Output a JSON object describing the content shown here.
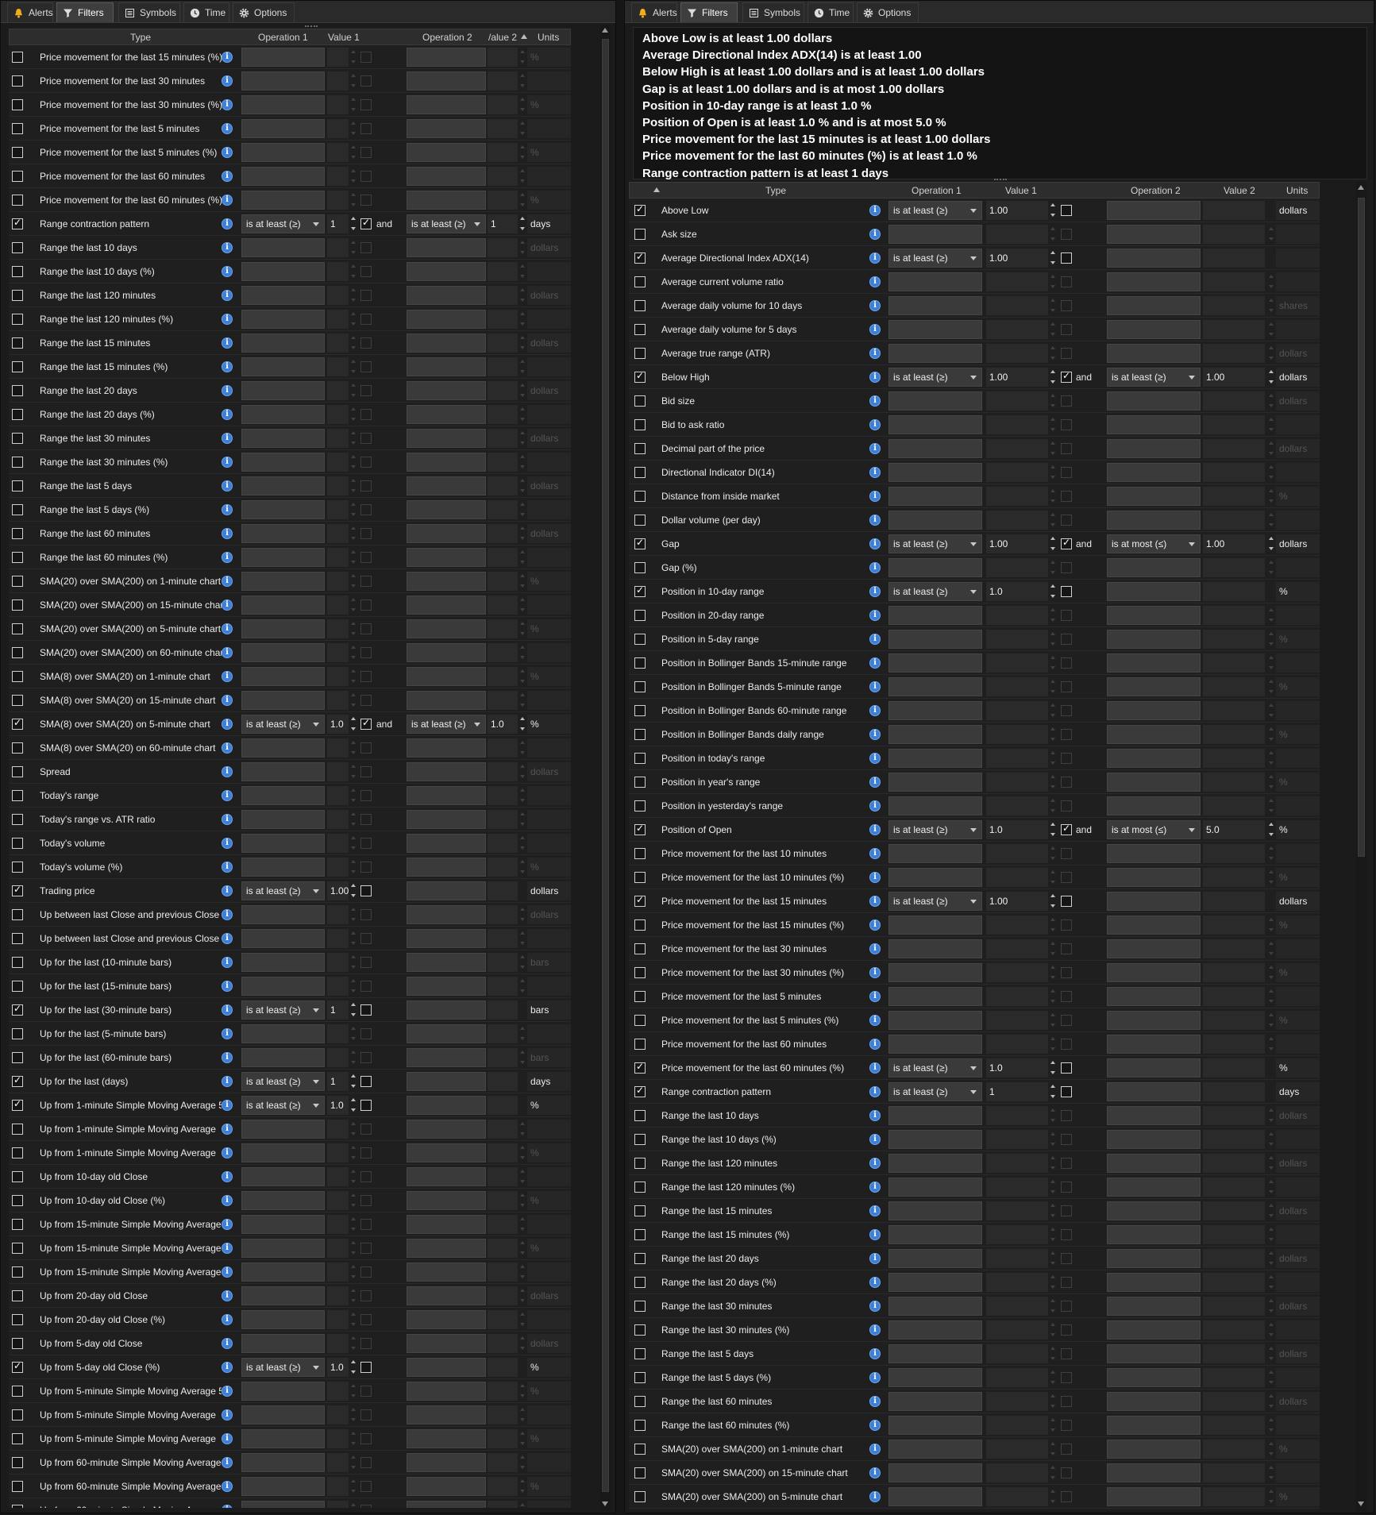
{
  "tabs": [
    {
      "label": "Alerts",
      "icon": "bell-icon"
    },
    {
      "label": "Filters",
      "icon": "funnel-icon",
      "active": true
    },
    {
      "label": "Symbols",
      "icon": "list-icon"
    },
    {
      "label": "Time",
      "icon": "clock-icon"
    },
    {
      "label": "Options",
      "icon": "gear-icon"
    }
  ],
  "and_label": "and",
  "left": {
    "headers": {
      "type": "Type",
      "op1": "Operation 1",
      "val1": "Value 1",
      "op2": "Operation 2",
      "val2": "/alue 2",
      "units": "Units"
    },
    "rows": [
      {
        "label": "Price movement for the last 15 minutes (%)",
        "units": "%"
      },
      {
        "label": "Price movement for the last 30 minutes"
      },
      {
        "label": "Price movement for the last 30 minutes (%)",
        "units": "%"
      },
      {
        "label": "Price movement for the last 5 minutes"
      },
      {
        "label": "Price movement for the last 5 minutes (%)",
        "units": "%"
      },
      {
        "label": "Price movement for the last 60 minutes"
      },
      {
        "label": "Price movement for the last 60 minutes (%)",
        "units": "%"
      },
      {
        "label": "Range contraction pattern",
        "checked": true,
        "op1": "is at least (≥)",
        "val1": "1",
        "and": true,
        "op2": "is at least (≥)",
        "val2": "1",
        "units": "days"
      },
      {
        "label": "Range the last 10 days",
        "units": "dollars"
      },
      {
        "label": "Range the last 10 days (%)"
      },
      {
        "label": "Range the last 120 minutes",
        "units": "dollars"
      },
      {
        "label": "Range the last 120 minutes (%)"
      },
      {
        "label": "Range the last 15 minutes",
        "units": "dollars"
      },
      {
        "label": "Range the last 15 minutes (%)"
      },
      {
        "label": "Range the last 20 days",
        "units": "dollars"
      },
      {
        "label": "Range the last 20 days (%)"
      },
      {
        "label": "Range the last 30 minutes",
        "units": "dollars"
      },
      {
        "label": "Range the last 30 minutes (%)"
      },
      {
        "label": "Range the last 5 days",
        "units": "dollars"
      },
      {
        "label": "Range the last 5 days (%)"
      },
      {
        "label": "Range the last 60 minutes",
        "units": "dollars"
      },
      {
        "label": "Range the last 60 minutes (%)"
      },
      {
        "label": "SMA(20) over SMA(200) on 1-minute chart",
        "units": "%"
      },
      {
        "label": "SMA(20) over SMA(200) on 15-minute chart"
      },
      {
        "label": "SMA(20) over SMA(200) on 5-minute chart",
        "units": "%"
      },
      {
        "label": "SMA(20) over SMA(200) on 60-minute chart"
      },
      {
        "label": "SMA(8) over SMA(20) on 1-minute chart",
        "units": "%"
      },
      {
        "label": "SMA(8) over SMA(20) on 15-minute chart"
      },
      {
        "label": "SMA(8) over SMA(20) on 5-minute chart",
        "checked": true,
        "op1": "is at least (≥)",
        "val1": "1.0",
        "and": true,
        "op2": "is at least (≥)",
        "val2": "1.0",
        "units": "%"
      },
      {
        "label": "SMA(8) over SMA(20) on 60-minute chart"
      },
      {
        "label": "Spread",
        "units": "dollars"
      },
      {
        "label": "Today's range"
      },
      {
        "label": "Today's range vs. ATR ratio"
      },
      {
        "label": "Today's volume"
      },
      {
        "label": "Today's volume (%)",
        "units": "%"
      },
      {
        "label": "Trading price",
        "checked": true,
        "op1": "is at least (≥)",
        "val1": "1.00",
        "and": false,
        "units": "dollars"
      },
      {
        "label": "Up between last Close and previous Close",
        "units": "dollars"
      },
      {
        "label": "Up between last Close and previous Close (%"
      },
      {
        "label": "Up for the last (10-minute bars)",
        "units": "bars"
      },
      {
        "label": "Up for the last (15-minute bars)"
      },
      {
        "label": "Up for the last (30-minute bars)",
        "checked": true,
        "op1": "is at least (≥)",
        "val1": "1",
        "and": false,
        "units": "bars"
      },
      {
        "label": "Up for the last (5-minute bars)"
      },
      {
        "label": "Up for the last (60-minute bars)",
        "units": "bars"
      },
      {
        "label": "Up for the last (days)",
        "checked": true,
        "op1": "is at least (≥)",
        "val1": "1",
        "and": false,
        "units": "days"
      },
      {
        "label": "Up from 1-minute Simple Moving Average 5",
        "checked": true,
        "op1": "is at least (≥)",
        "val1": "1.0",
        "and": false,
        "units": "%"
      },
      {
        "label": "Up from 1-minute Simple Moving Average"
      },
      {
        "label": "Up from 1-minute Simple Moving Average",
        "units": "%"
      },
      {
        "label": "Up from 10-day old Close"
      },
      {
        "label": "Up from 10-day old Close (%)",
        "units": "%"
      },
      {
        "label": "Up from 15-minute Simple Moving Average"
      },
      {
        "label": "Up from 15-minute Simple Moving Average",
        "units": "%"
      },
      {
        "label": "Up from 15-minute Simple Moving Average"
      },
      {
        "label": "Up from 20-day old Close",
        "units": "dollars"
      },
      {
        "label": "Up from 20-day old Close (%)"
      },
      {
        "label": "Up from 5-day old Close",
        "units": "dollars"
      },
      {
        "label": "Up from 5-day old Close (%)",
        "checked": true,
        "op1": "is at least (≥)",
        "val1": "1.0",
        "and": false,
        "units": "%"
      },
      {
        "label": "Up from 5-minute Simple Moving Average 5",
        "units": "%"
      },
      {
        "label": "Up from 5-minute Simple Moving Average"
      },
      {
        "label": "Up from 5-minute Simple Moving Average",
        "units": "%"
      },
      {
        "label": "Up from 60-minute Simple Moving Average"
      },
      {
        "label": "Up from 60-minute Simple Moving Average",
        "units": "%"
      },
      {
        "label": "Up from 60-minute Simple Moving Average"
      }
    ]
  },
  "right": {
    "summary": [
      "Above Low is at least 1.00 dollars",
      "Average Directional Index ADX(14) is at least 1.00",
      "Below High is at least 1.00 dollars and is at least 1.00 dollars",
      "Gap is at least 1.00 dollars and is at most 1.00 dollars",
      "Position in 10-day range is at least 1.0 %",
      "Position of Open is at least 1.0 % and is at most 5.0 %",
      "Price movement for the last 15 minutes is at least 1.00 dollars",
      "Price movement for the last 60 minutes (%) is at least 1.0 %",
      "Range contraction pattern is at least 1 days"
    ],
    "headers": {
      "type": "Type",
      "op1": "Operation 1",
      "val1": "Value 1",
      "op2": "Operation 2",
      "val2": "Value 2",
      "units": "Units"
    },
    "rows": [
      {
        "label": "Above Low",
        "checked": true,
        "op1": "is at least (≥)",
        "val1": "1.00",
        "and": false,
        "units": "dollars"
      },
      {
        "label": "Ask size"
      },
      {
        "label": "Average Directional Index ADX(14)",
        "checked": true,
        "op1": "is at least (≥)",
        "val1": "1.00",
        "and": false
      },
      {
        "label": "Average current volume ratio"
      },
      {
        "label": "Average daily volume for 10 days",
        "units": "shares"
      },
      {
        "label": "Average daily volume for 5 days"
      },
      {
        "label": "Average true range (ATR)",
        "units": "dollars"
      },
      {
        "label": "Below High",
        "checked": true,
        "op1": "is at least (≥)",
        "val1": "1.00",
        "and": true,
        "op2": "is at least (≥)",
        "val2": "1.00",
        "units": "dollars"
      },
      {
        "label": "Bid size",
        "units": "dollars"
      },
      {
        "label": "Bid to ask ratio"
      },
      {
        "label": "Decimal part of the price",
        "units": "dollars"
      },
      {
        "label": "Directional Indicator DI(14)"
      },
      {
        "label": "Distance from inside market",
        "units": "%"
      },
      {
        "label": "Dollar volume (per day)"
      },
      {
        "label": "Gap",
        "checked": true,
        "op1": "is at least (≥)",
        "val1": "1.00",
        "and": true,
        "op2": "is at most (≤)",
        "val2": "1.00",
        "units": "dollars"
      },
      {
        "label": "Gap (%)"
      },
      {
        "label": "Position in 10-day range",
        "checked": true,
        "op1": "is at least (≥)",
        "val1": "1.0",
        "and": false,
        "units": "%"
      },
      {
        "label": "Position in 20-day range"
      },
      {
        "label": "Position in 5-day range",
        "units": "%"
      },
      {
        "label": "Position in Bollinger Bands 15-minute range"
      },
      {
        "label": "Position in Bollinger Bands 5-minute range",
        "units": "%"
      },
      {
        "label": "Position in Bollinger Bands 60-minute range"
      },
      {
        "label": "Position in Bollinger Bands daily range",
        "units": "%"
      },
      {
        "label": "Position in today's range"
      },
      {
        "label": "Position in year's range",
        "units": "%"
      },
      {
        "label": "Position in yesterday's range"
      },
      {
        "label": "Position of Open",
        "checked": true,
        "op1": "is at least (≥)",
        "val1": "1.0",
        "and": true,
        "op2": "is at most (≤)",
        "val2": "5.0",
        "units": "%"
      },
      {
        "label": "Price movement for the last 10 minutes"
      },
      {
        "label": "Price movement for the last 10 minutes (%)",
        "units": "%"
      },
      {
        "label": "Price movement for the last 15 minutes",
        "checked": true,
        "op1": "is at least (≥)",
        "val1": "1.00",
        "and": false,
        "units": "dollars"
      },
      {
        "label": "Price movement for the last 15 minutes (%)",
        "units": "%"
      },
      {
        "label": "Price movement for the last 30 minutes"
      },
      {
        "label": "Price movement for the last 30 minutes (%)",
        "units": "%"
      },
      {
        "label": "Price movement for the last 5 minutes"
      },
      {
        "label": "Price movement for the last 5 minutes (%)",
        "units": "%"
      },
      {
        "label": "Price movement for the last 60 minutes"
      },
      {
        "label": "Price movement for the last 60 minutes (%)",
        "checked": true,
        "op1": "is at least (≥)",
        "val1": "1.0",
        "and": false,
        "units": "%"
      },
      {
        "label": "Range contraction pattern",
        "checked": true,
        "op1": "is at least (≥)",
        "val1": "1",
        "and": false,
        "units": "days"
      },
      {
        "label": "Range the last 10 days",
        "units": "dollars"
      },
      {
        "label": "Range the last 10 days (%)"
      },
      {
        "label": "Range the last 120 minutes",
        "units": "dollars"
      },
      {
        "label": "Range the last 120 minutes (%)"
      },
      {
        "label": "Range the last 15 minutes",
        "units": "dollars"
      },
      {
        "label": "Range the last 15 minutes (%)"
      },
      {
        "label": "Range the last 20 days",
        "units": "dollars"
      },
      {
        "label": "Range the last 20 days (%)"
      },
      {
        "label": "Range the last 30 minutes",
        "units": "dollars"
      },
      {
        "label": "Range the last 30 minutes (%)"
      },
      {
        "label": "Range the last 5 days",
        "units": "dollars"
      },
      {
        "label": "Range the last 5 days (%)"
      },
      {
        "label": "Range the last 60 minutes",
        "units": "dollars"
      },
      {
        "label": "Range the last 60 minutes (%)"
      },
      {
        "label": "SMA(20) over SMA(200) on 1-minute chart",
        "units": "%"
      },
      {
        "label": "SMA(20) over SMA(200) on 15-minute chart"
      },
      {
        "label": "SMA(20) over SMA(200) on 5-minute chart",
        "units": "%"
      }
    ]
  }
}
